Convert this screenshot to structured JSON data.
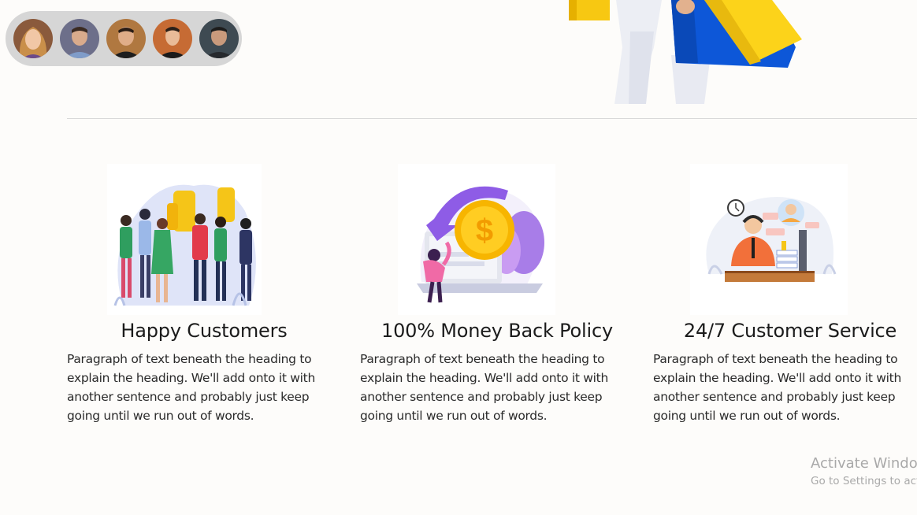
{
  "avatars": [
    {
      "name": "avatar-1"
    },
    {
      "name": "avatar-2"
    },
    {
      "name": "avatar-3"
    },
    {
      "name": "avatar-4"
    },
    {
      "name": "avatar-5"
    }
  ],
  "colors": {
    "background": "#fdfcfa",
    "avatar_bar": "#d6d6d6",
    "bag_blue": "#0d57d8",
    "bag_yellow": "#fcd31a",
    "coin_gold": "#f7b500",
    "arrow_purple": "#8e5ce6"
  },
  "features": [
    {
      "title": "Happy Customers",
      "text": "Paragraph of text beneath the heading to explain the heading. We'll add onto it with another sentence and probably just keep going until we run out of words.",
      "illustration": "cheering-crowd-thumbs-up-illustration"
    },
    {
      "title": "100% Money Back Policy",
      "text": "Paragraph of text beneath the heading to explain the heading. We'll add onto it with another sentence and probably just keep going until we run out of words.",
      "illustration": "money-back-coin-illustration"
    },
    {
      "title": "24/7 Customer Service",
      "text": "Paragraph of text beneath the heading to explain the heading. We'll add onto it with another sentence and probably just keep going until we run out of words.",
      "illustration": "support-agent-headset-illustration"
    }
  ],
  "watermark": {
    "line1": "Activate Windows",
    "line2": "Go to Settings to activate Windows."
  }
}
